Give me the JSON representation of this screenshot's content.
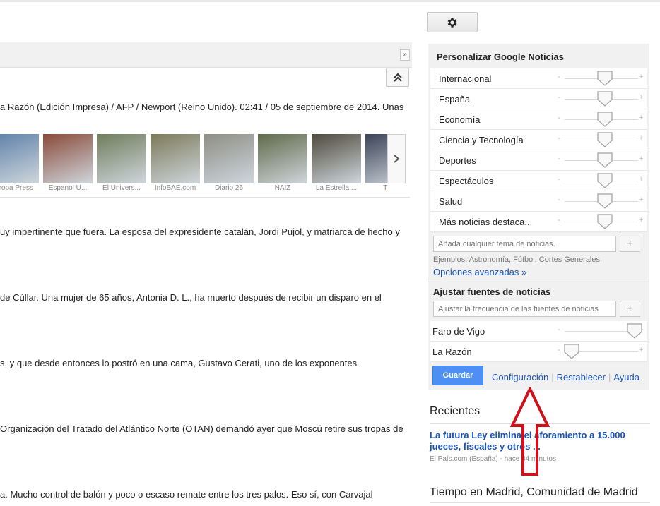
{
  "settings": {
    "icon": "gear-icon"
  },
  "stories": [
    {
      "text": "a Razón (Edición Impresa) / AFP / Newport (Reino Unido). 02:41 / 05 de septiembre de 2014. Unas"
    },
    {
      "text": "uy impertinente que fuera. La esposa del expresidente catalán, Jordi Pujol, y matriarca de hecho y"
    },
    {
      "text": "de Cúllar. Una mujer de 65 años, Antonia D. L., ha muerto después de recibir un disparo en el"
    },
    {
      "text": "s, y que desde entonces lo postró en una cama, Gustavo Cerati, uno de los exponentes"
    },
    {
      "text": " Organización del Tratado del Atlántico Norte (OTAN) demandó ayer que Moscú retire sus tropas de"
    },
    {
      "text": "a. Mucho control de balón y poco o escaso remate entre los tres palos. Eso sí, con Carvajal"
    }
  ],
  "thumbnails": [
    {
      "caption": "uropa Press",
      "color": "#5b7fa8"
    },
    {
      "caption": "Espanol U...",
      "color": "#8a4a3a"
    },
    {
      "caption": "El Univers...",
      "color": "#6f7d5c"
    },
    {
      "caption": "InfoBAE.com",
      "color": "#7c7a5a"
    },
    {
      "caption": "Diario 26",
      "color": "#8e8e86"
    },
    {
      "caption": "NAIZ",
      "color": "#5f6a4a"
    },
    {
      "caption": "La Estrella ...",
      "color": "#4e4a3c"
    },
    {
      "caption": "Te Ir",
      "color": "#3a4256"
    }
  ],
  "panel": {
    "title": "Personalizar Google Noticias",
    "topics": [
      {
        "label": "Internacional",
        "level": 0.55
      },
      {
        "label": "España",
        "level": 0.55
      },
      {
        "label": "Economía",
        "level": 0.55
      },
      {
        "label": "Ciencia y Tecnología",
        "level": 0.55
      },
      {
        "label": "Deportes",
        "level": 0.55
      },
      {
        "label": "Espectáculos",
        "level": 0.55
      },
      {
        "label": "Salud",
        "level": 0.55
      },
      {
        "label": "Más noticias destaca...",
        "level": 0.55
      }
    ],
    "add_topic_placeholder": "Añada cualquier tema de noticias.",
    "add_label": "+",
    "minus": "-",
    "plus": "+",
    "examples": "Ejemplos: Astronomía, Fútbol, Cortes Generales",
    "advanced_link": "Opciones avanzadas »",
    "sources_title": "Ajustar fuentes de noticias",
    "sources_placeholder": "Ajustar la frecuencia de las fuentes de noticias",
    "sources": [
      {
        "label": "Faro de Vigo",
        "level": 0.95
      },
      {
        "label": "La Razón",
        "level": 0.1
      }
    ],
    "save_label": "Guardar",
    "links": [
      "Configuración",
      "Restablecer",
      "Ayuda"
    ]
  },
  "recent": {
    "title": "Recientes",
    "headline": "La futura Ley elimina el aforamiento a 15.000 jueces, fiscales y otros ...",
    "meta": "El País.com (España) - hace 34 minutos"
  },
  "weather": {
    "title": "Tiempo en Madrid, Comunidad de Madrid"
  },
  "colors": {
    "link": "#1a54b8",
    "save": "#4d8ff2",
    "arrow": "#d0101a"
  }
}
